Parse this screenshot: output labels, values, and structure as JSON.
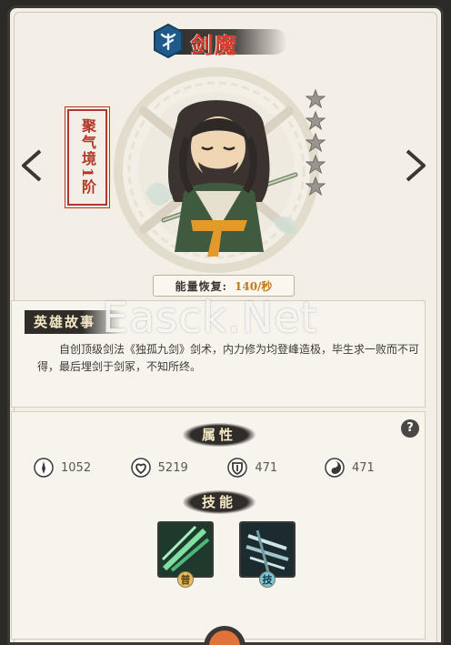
{
  "hero": {
    "name": "剑魔",
    "realm": "聚气境1阶",
    "stars_total": 5,
    "stars_filled": 0
  },
  "energy": {
    "label": "能量恢复:",
    "value": "140/秒"
  },
  "story": {
    "heading": "英雄故事",
    "text": "自创顶级剑法《独孤九剑》剑术，内力修为均登峰造极，毕生求一败而不可得，最后埋剑于剑冢，不知所终。"
  },
  "watermark": "Easck.Net",
  "attributes": {
    "heading": "属性",
    "help_label": "?",
    "stats": [
      {
        "icon": "attack-icon",
        "value": "1052"
      },
      {
        "icon": "health-icon",
        "value": "5219"
      },
      {
        "icon": "defense-icon",
        "value": "471"
      },
      {
        "icon": "agility-icon",
        "value": "471"
      }
    ]
  },
  "skills": {
    "heading": "技能",
    "items": [
      {
        "badge": "普",
        "badge_color": "#e6c15a"
      },
      {
        "badge": "技",
        "badge_color": "#7bc4d9"
      }
    ]
  },
  "colors": {
    "accent_red": "#d53a2a",
    "energy_orange": "#c57a1c",
    "dark_ink": "#2f2c2a"
  }
}
